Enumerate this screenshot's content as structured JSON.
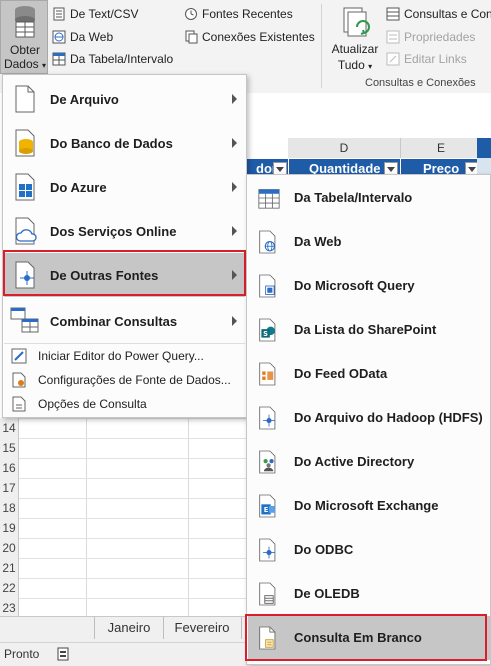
{
  "ribbon": {
    "obter_dados_line1": "Obter",
    "obter_dados_line2": "Dados",
    "de_text_csv": "De Text/CSV",
    "da_web": "Da Web",
    "da_tabela_intervalo": "Da Tabela/Intervalo",
    "fontes_recentes": "Fontes Recentes",
    "conexoes_existentes": "Conexões Existentes",
    "atualizar_line1": "Atualizar",
    "atualizar_line2": "Tudo",
    "consultas_e_conexoes": "Consultas e Cone",
    "propriedades": "Propriedades",
    "editar_links": "Editar Links",
    "group_label": "Consultas e Conexões"
  },
  "sheet": {
    "col_d": "D",
    "col_e": "E",
    "hdr_partial_left": "dor",
    "hdr_quantidade": "Quantidade",
    "hdr_preco": "Preço",
    "row_numbers": [
      "14",
      "15",
      "16",
      "17",
      "18",
      "19",
      "20",
      "21",
      "22",
      "23"
    ]
  },
  "tabs": {
    "janeiro": "Janeiro",
    "fevereiro": "Fevereiro"
  },
  "status": {
    "text": "Pronto"
  },
  "main_menu": {
    "items": [
      {
        "label": "De Arquivo",
        "icon": "file-icon"
      },
      {
        "label": "Do Banco de Dados",
        "icon": "database-icon"
      },
      {
        "label": "Do Azure",
        "icon": "windows-icon"
      },
      {
        "label": "Dos Serviços Online",
        "icon": "cloud-icon"
      },
      {
        "label": "De Outras Fontes",
        "icon": "other-sources-icon"
      },
      {
        "label": "Combinar Consultas",
        "icon": "combine-icon"
      }
    ],
    "small_items": [
      {
        "label": "Iniciar Editor do Power Query...",
        "icon": "editor-icon"
      },
      {
        "label": "Configurações de Fonte de Dados...",
        "icon": "settings-icon"
      },
      {
        "label": "Opções de Consulta",
        "icon": "options-icon"
      }
    ]
  },
  "sub_menu": {
    "items": [
      {
        "label": "Da Tabela/Intervalo",
        "icon": "table-icon"
      },
      {
        "label": "Da Web",
        "icon": "globe-icon"
      },
      {
        "label": "Do Microsoft Query",
        "icon": "microsoft-query-icon"
      },
      {
        "label": "Da Lista do SharePoint",
        "icon": "sharepoint-icon"
      },
      {
        "label": "Do Feed OData",
        "icon": "odata-icon"
      },
      {
        "label": "Do Arquivo do Hadoop (HDFS)",
        "icon": "hadoop-icon"
      },
      {
        "label": "Do Active Directory",
        "icon": "active-directory-icon"
      },
      {
        "label": "Do Microsoft Exchange",
        "icon": "exchange-icon"
      },
      {
        "label": "Do ODBC",
        "icon": "odbc-icon"
      },
      {
        "label": "De OLEDB",
        "icon": "oledb-icon"
      },
      {
        "label": "Consulta Em Branco",
        "icon": "blank-query-icon"
      }
    ]
  },
  "colors": {
    "highlight": "#c6c6c6",
    "red_outline": "#d9202a",
    "header_blue": "#1f5ca8"
  }
}
